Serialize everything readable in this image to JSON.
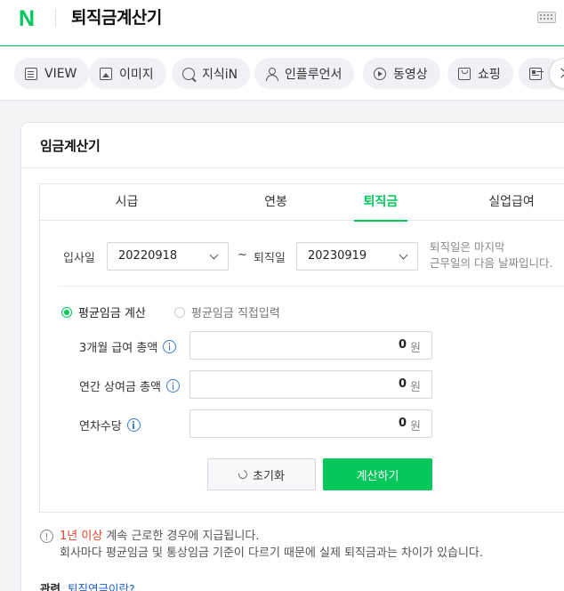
{
  "header": {
    "logo": "N",
    "query": "퇴직금계산기"
  },
  "tabs": [
    {
      "label": "VIEW",
      "icon": "document-icon"
    },
    {
      "label": "이미지",
      "icon": "image-icon"
    },
    {
      "label": "지식iN",
      "icon": "q-icon"
    },
    {
      "label": "인플루언서",
      "icon": "person-icon"
    },
    {
      "label": "동영상",
      "icon": "play-icon"
    },
    {
      "label": "쇼핑",
      "icon": "shopping-bag-icon"
    },
    {
      "label": "",
      "icon": "news-icon"
    }
  ],
  "calculator": {
    "title": "임금계산기",
    "tabs": [
      "시급",
      "연봉",
      "퇴직금",
      "실업급여"
    ],
    "active_tab": "퇴직금",
    "join_label": "입사일",
    "join_date": "20220918",
    "tilde": "~",
    "leave_label": "퇴직일",
    "leave_date": "20230919",
    "help_line1": "퇴직일은 마지막",
    "help_line2": "근무일의 다음 날짜입니다.",
    "radio_avg_calc": "평균임금 계산",
    "radio_avg_direct": "평균임금 직접입력",
    "fields": [
      {
        "label": "3개월 급여 총액",
        "value": "0",
        "unit": "원"
      },
      {
        "label": "연간 상여금 총액",
        "value": "0",
        "unit": "원"
      },
      {
        "label": "연차수당",
        "value": "0",
        "unit": "원"
      }
    ],
    "reset_label": "초기화",
    "calc_label": "계산하기",
    "notice_highlight": "1년 이상",
    "notice_line1_rest": " 계속 근로한 경우에 지급됩니다.",
    "notice_line2": "회사마다 평균임금 및 통상임금 기준이 다르기 때문에 실제 퇴직금과는 차이가 있습니다.",
    "related_label": "관련",
    "related_link": "퇴직연금이란?"
  },
  "colors": {
    "brand_green": "#03c75a",
    "highlight_red": "#e5432f",
    "link_blue": "#1a5ac4"
  }
}
